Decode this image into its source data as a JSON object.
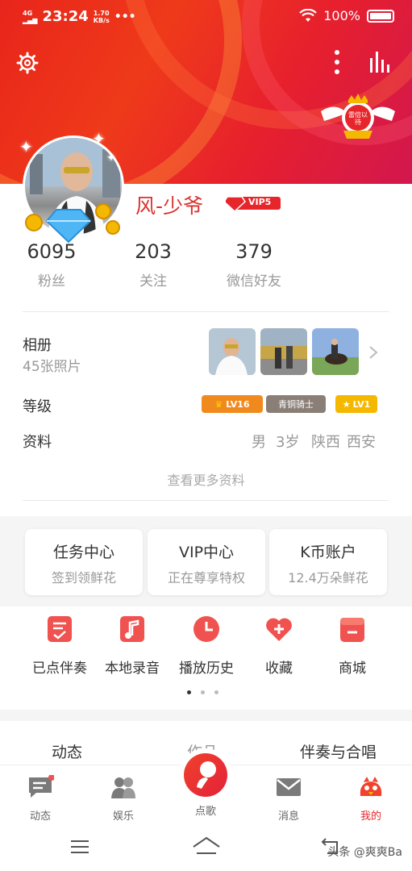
{
  "status_bar": {
    "network": "4G",
    "time": "23:24",
    "speed_value": "1.70",
    "speed_unit": "KB/s",
    "dots": "•••",
    "battery": "100%"
  },
  "header": {
    "badge_text": "雷倍以待"
  },
  "profile": {
    "nickname": "风-少爷",
    "vip_label": "VIP5"
  },
  "stats": [
    {
      "value": "6095",
      "label": "粉丝"
    },
    {
      "value": "203",
      "label": "关注"
    },
    {
      "value": "379",
      "label": "微信好友"
    }
  ],
  "album": {
    "label": "相册",
    "count": "45张照片"
  },
  "level": {
    "label": "等级",
    "badges": [
      "LV16",
      "青铜骑士",
      "LV1"
    ]
  },
  "info": {
    "label": "资料",
    "gender": "男",
    "age": "3岁",
    "province": "陕西",
    "city": "西安",
    "more_link": "查看更多资料"
  },
  "cards": [
    {
      "title": "任务中心",
      "sub": "签到领鲜花"
    },
    {
      "title": "VIP中心",
      "sub": "正在尊享特权"
    },
    {
      "title": "K币账户",
      "sub": "12.4万朵鲜花"
    }
  ],
  "tools": [
    {
      "label": "已点伴奏",
      "icon": "checklist-icon"
    },
    {
      "label": "本地录音",
      "icon": "music-note-icon"
    },
    {
      "label": "播放历史",
      "icon": "clock-icon"
    },
    {
      "label": "收藏",
      "icon": "heart-plus-icon"
    },
    {
      "label": "商城",
      "icon": "shop-icon"
    }
  ],
  "tabs": [
    {
      "label": "动态"
    },
    {
      "label": "作品"
    },
    {
      "label": "伴奏与合唱"
    }
  ],
  "bottom_nav": [
    {
      "label": "动态",
      "icon": "message-icon"
    },
    {
      "label": "娱乐",
      "icon": "people-icon"
    },
    {
      "label": "点歌",
      "icon": "mic-icon"
    },
    {
      "label": "消息",
      "icon": "mail-icon"
    },
    {
      "label": "我的",
      "icon": "bird-icon"
    }
  ],
  "watermark": "头条 @爽爽Ba",
  "colors": {
    "brand_red": "#e7262b",
    "accent_gold": "#f5b800"
  }
}
